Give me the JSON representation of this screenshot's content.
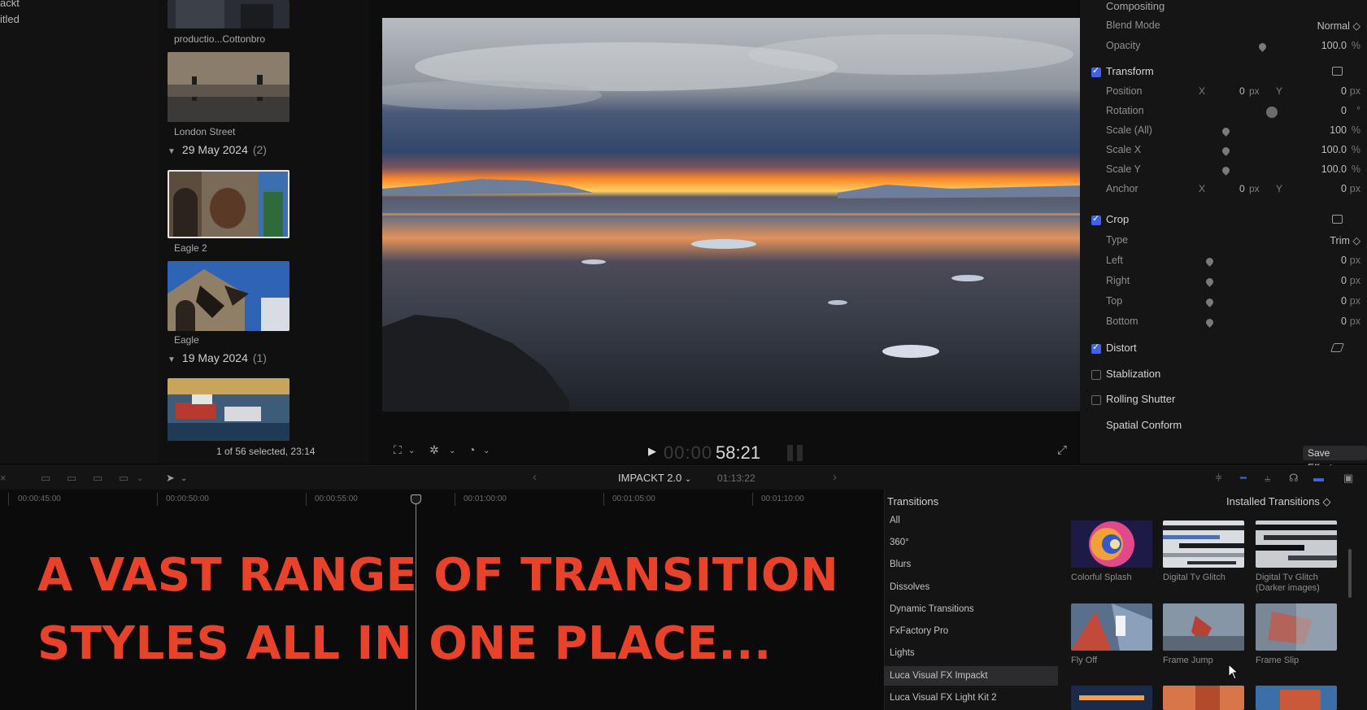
{
  "library": {
    "projects": [
      "ackt",
      "itled"
    ]
  },
  "browser": {
    "clips": [
      {
        "label": "productio...Cottonbro"
      },
      {
        "label": "London Street"
      },
      {
        "label": "Eagle 2"
      },
      {
        "label": "Eagle"
      }
    ],
    "date_groups": [
      {
        "date": "29 May 2024",
        "count": "(2)"
      },
      {
        "date": "19 May 2024",
        "count": "(1)"
      }
    ],
    "selection_status": "1 of 56 selected, 23:14"
  },
  "viewer": {
    "timecode_dim": "00:00",
    "timecode": "58:21"
  },
  "inspector": {
    "compositing": "Compositing",
    "blend_mode": {
      "label": "Blend Mode",
      "value": "Normal ◇"
    },
    "opacity": {
      "label": "Opacity",
      "value": "100.0",
      "unit": "%"
    },
    "transform": {
      "label": "Transform",
      "checked": true
    },
    "position": {
      "label": "Position",
      "x_axis": "X",
      "x": "0",
      "x_unit": "px",
      "y_axis": "Y",
      "y": "0",
      "y_unit": "px"
    },
    "rotation": {
      "label": "Rotation",
      "value": "0",
      "unit": "°"
    },
    "scale_all": {
      "label": "Scale (All)",
      "value": "100",
      "unit": "%"
    },
    "scale_x": {
      "label": "Scale X",
      "value": "100.0",
      "unit": "%"
    },
    "scale_y": {
      "label": "Scale Y",
      "value": "100.0",
      "unit": "%"
    },
    "anchor": {
      "label": "Anchor",
      "x_axis": "X",
      "x": "0",
      "x_unit": "px",
      "y_axis": "Y",
      "y": "0",
      "y_unit": "px"
    },
    "crop": {
      "label": "Crop",
      "checked": true
    },
    "crop_type": {
      "label": "Type",
      "value": "Trim ◇"
    },
    "left": {
      "label": "Left",
      "value": "0",
      "unit": "px"
    },
    "right": {
      "label": "Right",
      "value": "0",
      "unit": "px"
    },
    "top": {
      "label": "Top",
      "value": "0",
      "unit": "px"
    },
    "bottom": {
      "label": "Bottom",
      "value": "0",
      "unit": "px"
    },
    "distort": {
      "label": "Distort",
      "checked": true
    },
    "stabilization": {
      "label": "Stablization",
      "checked": false
    },
    "rolling_shutter": {
      "label": "Rolling Shutter",
      "checked": false
    },
    "spatial_conform": "Spatial Conform",
    "save_effects": "Save Effects"
  },
  "timeline": {
    "project_name": "IMPACKT 2.0",
    "project_duration": "01:13:22",
    "ruler": [
      "00:00:45:00",
      "00:00:50:00",
      "00:00:55:00",
      "00:01:00:00",
      "00:01:05:00",
      "00:01:10:00"
    ],
    "overlay_line1": "A VAST RANGE OF TRANSITION",
    "overlay_line2": "STYLES ALL IN ONE PLACE...",
    "overlay_color": "#e8432a"
  },
  "transitions": {
    "title": "Transitions",
    "installed": "Installed Transitions ◇",
    "categories": [
      "All",
      "360°",
      "Blurs",
      "Dissolves",
      "Dynamic Transitions",
      "FxFactory Pro",
      "Lights",
      "Luca Visual FX Impackt",
      "Luca Visual FX Light Kit 2"
    ],
    "selected_category": "Luca Visual FX Impackt",
    "items": [
      {
        "label": "Colorful Splash"
      },
      {
        "label": "Digital Tv Glitch"
      },
      {
        "label": "Digital Tv Glitch",
        "sub": "(Darker images)"
      },
      {
        "label": "Fly Off"
      },
      {
        "label": "Frame Jump"
      },
      {
        "label": "Frame Slip"
      }
    ]
  },
  "colors": {
    "accent_checkbox": "#3f62e6",
    "background": "#0b0b0c"
  }
}
